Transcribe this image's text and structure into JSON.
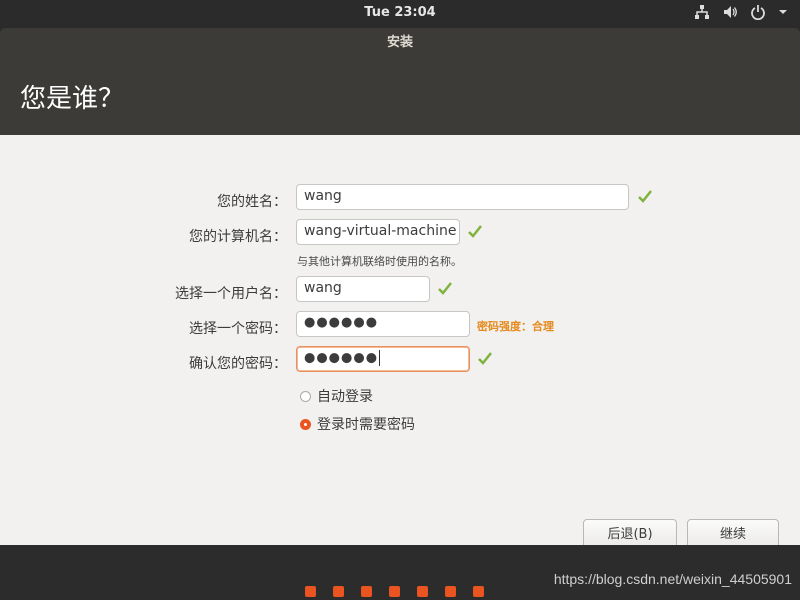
{
  "topbar": {
    "clock": "Tue 23:04",
    "icons": [
      "network-icon",
      "volume-icon",
      "power-icon",
      "dropdown-arrow-icon"
    ]
  },
  "window": {
    "title": "安装",
    "heading": "您是谁？"
  },
  "form": {
    "name_label": "您的姓名：",
    "name_value": "wang",
    "computer_label": "您的计算机名：",
    "computer_value": "wang-virtual-machine",
    "computer_hint": "与其他计算机联络时使用的名称。",
    "username_label": "选择一个用户名：",
    "username_value": "wang",
    "password_label": "选择一个密码：",
    "password_value": "●●●●●●",
    "password_strength": "密码强度：合理",
    "confirm_label": "确认您的密码：",
    "confirm_value": "●●●●●●",
    "login_options": [
      {
        "label": "自动登录",
        "selected": false
      },
      {
        "label": "登录时需要密码",
        "selected": true
      }
    ]
  },
  "buttons": {
    "back": "后退(B)",
    "continue": "继续"
  },
  "progress": {
    "dots": 7
  },
  "watermark": "https://blog.csdn.net/weixin_44505901",
  "colors": {
    "accent": "#e95420",
    "check": "#7fb33e",
    "strength": "#e58a1f",
    "header_bg": "#3c3b37"
  }
}
